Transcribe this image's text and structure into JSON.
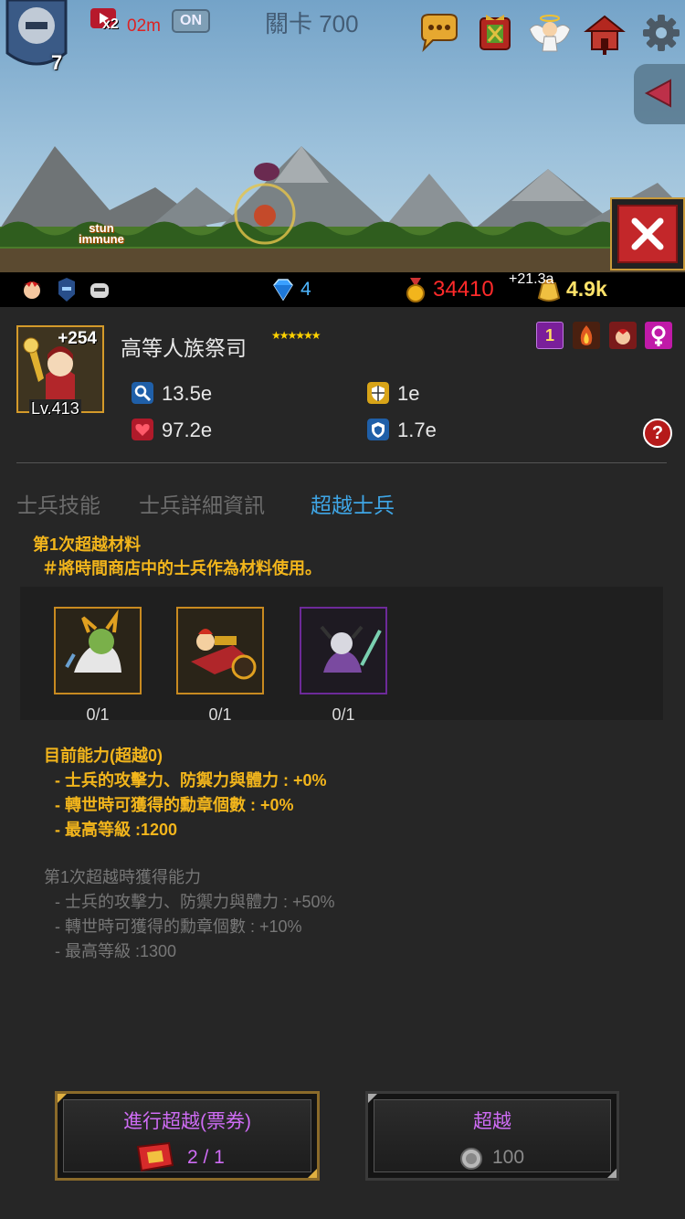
{
  "hud": {
    "hero_level": "7",
    "speed_multiplier": "x2",
    "speed_timer": "02m",
    "auto_toggle": "ON",
    "stage_label": "關卡 700",
    "stun_text_1": "stun",
    "stun_text_2": "immune"
  },
  "resources": {
    "gems": "4",
    "medals": "34410",
    "gold_rate": "+21.3a",
    "gold": "4.9k"
  },
  "unit": {
    "name": "高等人族祭司",
    "stars": "★★★★★★",
    "level": "Lv.413",
    "bonus": "+254",
    "attack": "13.5e",
    "hp": "97.2e",
    "defense": "1e",
    "magic_defense": "1.7e",
    "rank_badge": "1",
    "help": "?"
  },
  "tabs": [
    {
      "label": "士兵技能",
      "active": false
    },
    {
      "label": "士兵詳細資訊",
      "active": false
    },
    {
      "label": "超越士兵",
      "active": true
    }
  ],
  "transcend": {
    "material_title": "第1次超越材料",
    "material_desc": "＃將時間商店中的士兵作為材料使用。",
    "materials": [
      {
        "count": "0/1",
        "frame": "gold"
      },
      {
        "count": "0/1",
        "frame": "gold"
      },
      {
        "count": "0/1",
        "frame": "purple"
      }
    ],
    "current_title": "目前能力(超越0)",
    "current_lines": [
      "- 士兵的攻擊力、防禦力與體力 : +0%",
      "- 轉世時可獲得的勳章個數 : +0%",
      "- 最高等級 :1200"
    ],
    "next_title": "第1次超越時獲得能力",
    "next_lines": [
      "- 士兵的攻擊力、防禦力與體力 : +50%",
      "- 轉世時可獲得的勳章個數 : +10%",
      "- 最高等級 :1300"
    ]
  },
  "buttons": {
    "ticket_label": "進行超越(票券)",
    "ticket_cost": "2 / 1",
    "transcend_label": "超越",
    "transcend_cost": "100"
  },
  "colors": {
    "accent_tab": "#3fa6e6",
    "highlight_text": "#f2b51c",
    "button_label": "#cf6cf5",
    "medal_count": "#ff2a2a",
    "gem_count": "#4eb6ff"
  }
}
